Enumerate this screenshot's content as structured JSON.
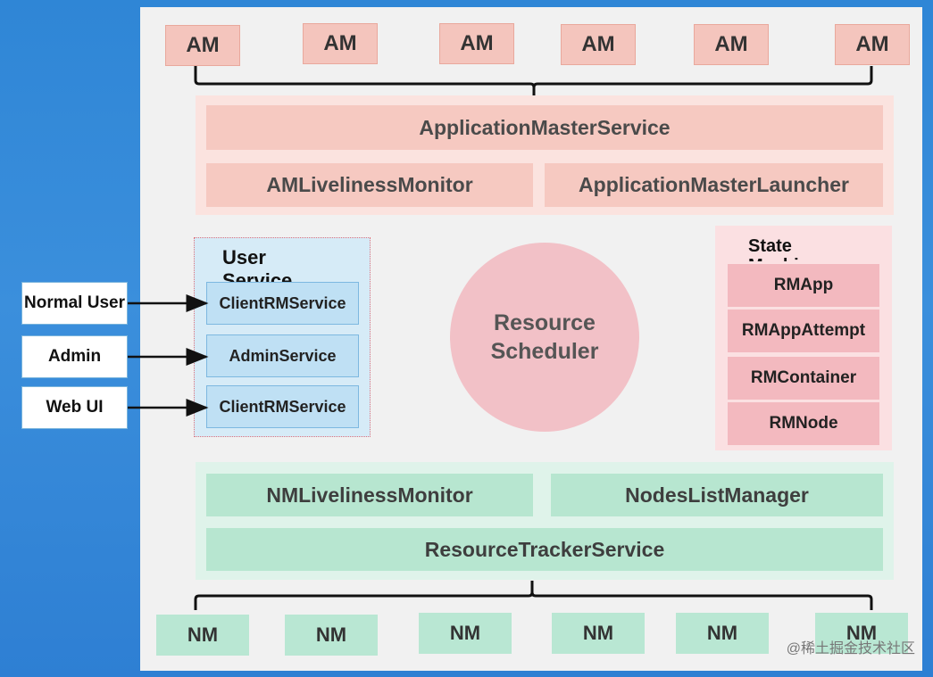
{
  "am_nodes": [
    "AM",
    "AM",
    "AM",
    "AM",
    "AM",
    "AM"
  ],
  "nm_nodes": [
    "NM",
    "NM",
    "NM",
    "NM",
    "NM",
    "NM"
  ],
  "rm_services": {
    "application_master_service": "ApplicationMasterService",
    "am_liveliness_monitor": "AMLivelinessMonitor",
    "application_master_launcher": "ApplicationMasterLauncher"
  },
  "user_service": {
    "title": "User Service",
    "items": [
      "ClientRMService",
      "AdminService",
      "ClientRMService"
    ]
  },
  "clients": [
    "Normal User",
    "Admin",
    "Web UI"
  ],
  "scheduler": "Resource Scheduler",
  "state_machine": {
    "title": "State Machine",
    "items": [
      "RMApp",
      "RMAppAttempt",
      "RMContainer",
      "RMNode"
    ]
  },
  "nm_services": {
    "nm_liveliness_monitor": "NMLivelinessMonitor",
    "nodes_list_manager": "NodesListManager",
    "resource_tracker_service": "ResourceTrackerService"
  },
  "watermark": "@稀土掘金技术社区"
}
